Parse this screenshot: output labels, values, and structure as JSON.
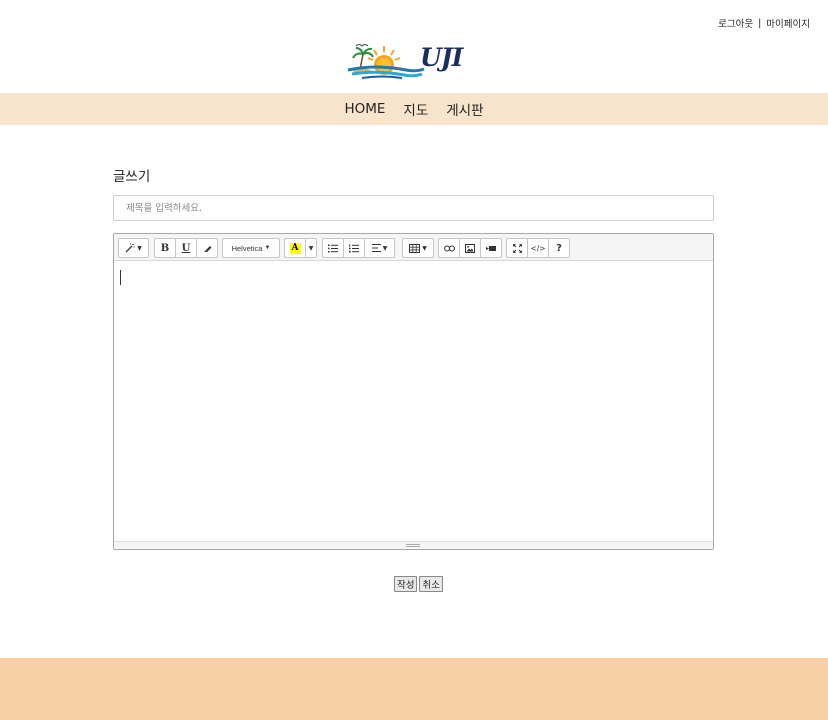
{
  "header": {
    "logout_label": "로그아웃",
    "separator": "|",
    "mypage_label": "마이페이지",
    "logo_text": "UJI"
  },
  "nav": {
    "items": [
      "HOME",
      "지도",
      "게시판"
    ]
  },
  "write": {
    "section_title": "글쓰기",
    "title_placeholder": "제목을 입력하세요.",
    "title_value": ""
  },
  "editor": {
    "font_name": "Helvetica",
    "color_letter": "A",
    "help_label": "?",
    "code_label": "</>",
    "bold_label": "B",
    "underline_label": "U"
  },
  "actions": {
    "submit_label": "작성",
    "cancel_label": "취소"
  },
  "colors": {
    "nav_bg": "#f8e4cc",
    "footer_bg": "#f7d0a8",
    "logo_text": "#1b2f5e"
  }
}
